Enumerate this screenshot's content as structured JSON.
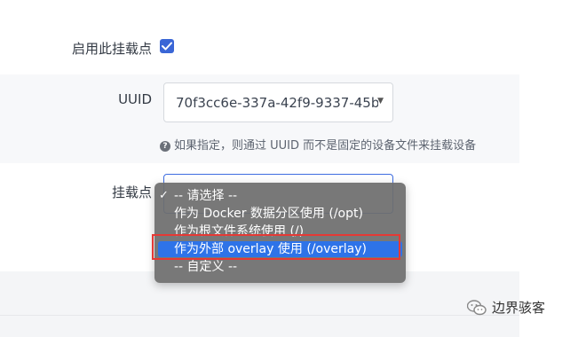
{
  "form": {
    "enable_mount_label": "启用此挂载点",
    "enable_mount_checked": true,
    "uuid_label": "UUID",
    "uuid_value": "70f3cc6e-337a-42f9-9337-45b",
    "uuid_hint": "如果指定，则通过 UUID 而不是固定的设备文件来挂载设备",
    "mount_point_label": "挂载点"
  },
  "dropdown": {
    "options": [
      "-- 请选择 --",
      "作为 Docker 数据分区使用 (/opt)",
      "作为根文件系统使用 (/)",
      "作为外部 overlay 使用 (/overlay)",
      "-- 自定义 --"
    ],
    "checked_index": 0,
    "highlighted_index": 3,
    "highlight_color": "#2e73e8"
  },
  "colors": {
    "accent": "#3a66d6",
    "annotation_red": "#e53935"
  },
  "watermark": {
    "text": "边界骇客"
  }
}
